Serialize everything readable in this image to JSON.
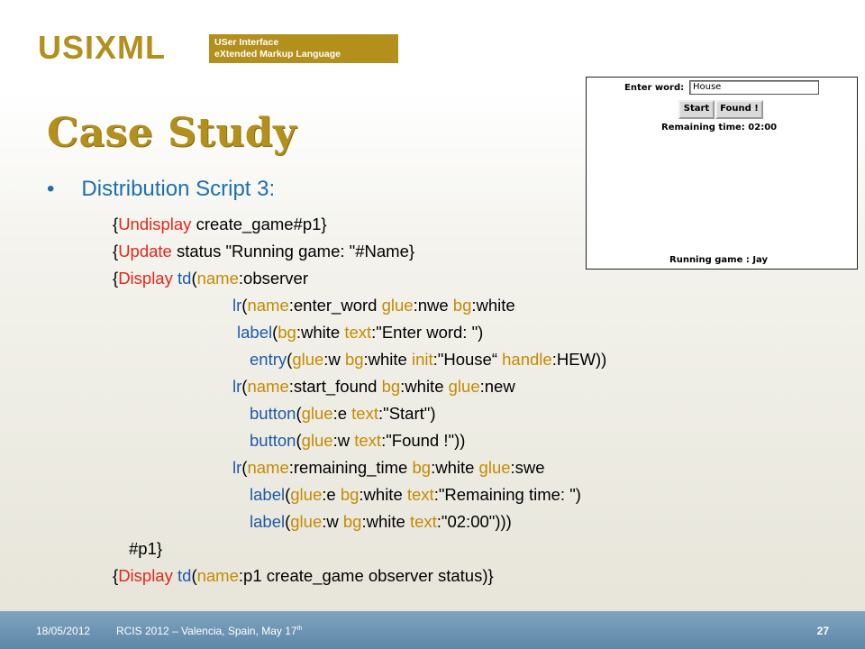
{
  "logo": {
    "wordmark": "USIXML",
    "tagline_1": "USer Interface",
    "tagline_2": "eXtended Markup Language"
  },
  "slide": {
    "title": "Case Study",
    "bullet": "Distribution Script 3:"
  },
  "code": {
    "l1": {
      "a": "{",
      "b": "Undisplay",
      "c": " create_game#p1}"
    },
    "l2": {
      "a": "{",
      "b": "Update",
      "c": " status \"Running game: \"#Name}"
    },
    "l3": {
      "a": "{",
      "b": "Display",
      "c": " ",
      "d": "td",
      "e": "(",
      "f": "name",
      "g": ":observer"
    },
    "l4": {
      "a": "lr",
      "b": "(",
      "c": "name",
      "d": ":enter_word ",
      "e": "glue",
      "f": ":nwe ",
      "g": "bg",
      "h": ":white"
    },
    "l5": {
      "a": "label",
      "b": "(",
      "c": "bg",
      "d": ":white ",
      "e": "text",
      "f": ":\"Enter word: \")"
    },
    "l6": {
      "a": "entry",
      "b": "(",
      "c": "glue",
      "d": ":w ",
      "e": "bg",
      "f": ":white ",
      "g": "init",
      "h": ":\"House“ ",
      "i": "handle",
      "j": ":HEW))"
    },
    "l7": {
      "a": "lr",
      "b": "(",
      "c": "name",
      "d": ":start_found ",
      "e": "bg",
      "f": ":white ",
      "g": "glue",
      "h": ":new"
    },
    "l8": {
      "a": "button",
      "b": "(",
      "c": "glue",
      "d": ":e ",
      "e": "text",
      "f": ":\"Start\")"
    },
    "l9": {
      "a": "button",
      "b": "(",
      "c": "glue",
      "d": ":w ",
      "e": "text",
      "f": ":\"Found !\"))"
    },
    "l10": {
      "a": "lr",
      "b": "(",
      "c": "name",
      "d": ":remaining_time ",
      "e": "bg",
      "f": ":white ",
      "g": "glue",
      "h": ":swe"
    },
    "l11": {
      "a": "label",
      "b": "(",
      "c": "glue",
      "d": ":e ",
      "e": "bg",
      "f": ":white ",
      "g": "text",
      "h": ":\"Remaining time: \")"
    },
    "l12": {
      "a": "label",
      "b": "(",
      "c": "glue",
      "d": ":w ",
      "e": "bg",
      "f": ":white ",
      "g": "text",
      "h": ":\"02:00\")))"
    },
    "l13": {
      "a": "#p1}"
    },
    "l14": {
      "a": "{",
      "b": "Display",
      "c": " ",
      "d": "td",
      "e": "(",
      "f": "name",
      "g": ":p1 create_game observer status)}"
    }
  },
  "screenshot": {
    "enter_label": "Enter word:",
    "entry_value": "House",
    "start_button": "Start",
    "found_button": "Found !",
    "remaining": "Remaining time:  02:00",
    "status": "Running game : Jay"
  },
  "footer": {
    "date": "18/05/2012",
    "conference": "RCIS 2012 – Valencia, Spain, May 17",
    "conference_sup": "th",
    "page": "27"
  },
  "colors": {
    "gold": "#b38f1c",
    "blue": "#1f6fae",
    "keyword_red": "#e0281a",
    "tag_blue": "#1e5aa8",
    "attr_orange": "#c58a00",
    "footer_blue": "#6b93b3"
  }
}
